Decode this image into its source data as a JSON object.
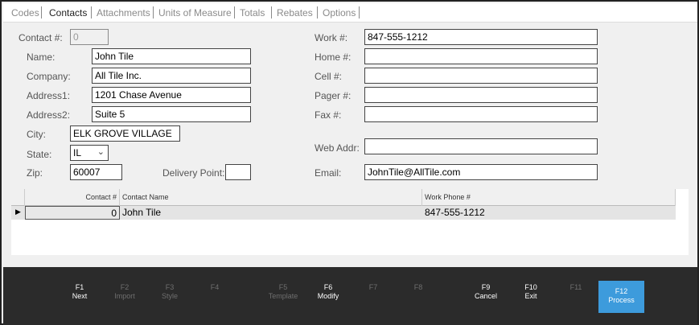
{
  "tabs": [
    "Codes",
    "Contacts",
    "Attachments",
    "Units of Measure",
    "Totals",
    "Rebates",
    "Options"
  ],
  "active_tab": "Contacts",
  "form": {
    "contact_no": {
      "label": "Contact #:",
      "value": "0"
    },
    "name": {
      "label": "Name:",
      "value": "John Tile"
    },
    "company": {
      "label": "Company:",
      "value": "All Tile Inc."
    },
    "address1": {
      "label": "Address1:",
      "value": "1201 Chase Avenue"
    },
    "address2": {
      "label": "Address2:",
      "value": "Suite 5"
    },
    "city": {
      "label": "City:",
      "value": "ELK GROVE VILLAGE"
    },
    "state": {
      "label": "State:",
      "value": "IL"
    },
    "zip": {
      "label": "Zip:",
      "value": "60007"
    },
    "delivery_point": {
      "label": "Delivery Point:",
      "value": ""
    },
    "work": {
      "label": "Work #:",
      "value": "847-555-1212"
    },
    "home": {
      "label": "Home #:",
      "value": ""
    },
    "cell": {
      "label": "Cell #:",
      "value": ""
    },
    "pager": {
      "label": "Pager #:",
      "value": ""
    },
    "fax": {
      "label": "Fax #:",
      "value": ""
    },
    "web": {
      "label": "Web Addr:",
      "value": ""
    },
    "email": {
      "label": "Email:",
      "value": "JohnTile@AllTile.com"
    }
  },
  "grid": {
    "headers": [
      "Contact #",
      "Contact Name",
      "Work Phone #"
    ],
    "rows": [
      {
        "contact_no": "0",
        "name": "John Tile",
        "phone": "847-555-1212"
      }
    ]
  },
  "footer": {
    "keys": [
      {
        "key": "F1",
        "label": "Next",
        "enabled": true
      },
      {
        "key": "F2",
        "label": "Import",
        "enabled": false
      },
      {
        "key": "F3",
        "label": "Style",
        "enabled": false
      },
      {
        "key": "F4",
        "label": "",
        "enabled": false
      },
      {
        "key": "F5",
        "label": "Template",
        "enabled": false
      },
      {
        "key": "F6",
        "label": "Modify",
        "enabled": true
      },
      {
        "key": "F7",
        "label": "",
        "enabled": false
      },
      {
        "key": "F8",
        "label": "",
        "enabled": false
      },
      {
        "key": "F9",
        "label": "Cancel",
        "enabled": true
      },
      {
        "key": "F10",
        "label": "Exit",
        "enabled": true
      },
      {
        "key": "F11",
        "label": "",
        "enabled": false
      },
      {
        "key": "F12",
        "label": "Process",
        "enabled": true
      }
    ]
  },
  "colors": {
    "accent": "#3d9bdc",
    "footer_bg": "#2b2b2b"
  }
}
